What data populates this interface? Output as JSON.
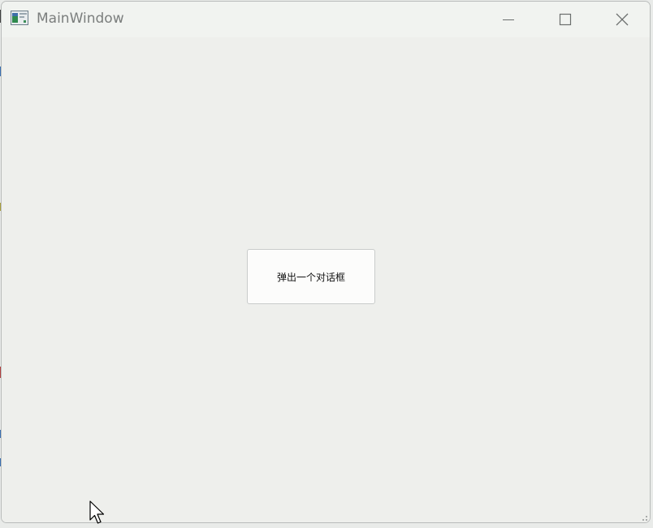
{
  "window": {
    "title": "MainWindow"
  },
  "main": {
    "dialog_button_label": "弹出一个对话框"
  },
  "icons": {
    "app": "app-window-icon",
    "minimize": "minimize-icon",
    "maximize": "maximize-icon",
    "close": "close-icon",
    "size_grip": "size-grip-icon",
    "cursor": "mouse-cursor-icon"
  },
  "colors": {
    "window_background": "#eeefec",
    "titlebar_background": "#f1f3f0",
    "title_text": "#7b7e7d",
    "button_background": "#fcfcfb",
    "button_border": "#c9cccb"
  }
}
